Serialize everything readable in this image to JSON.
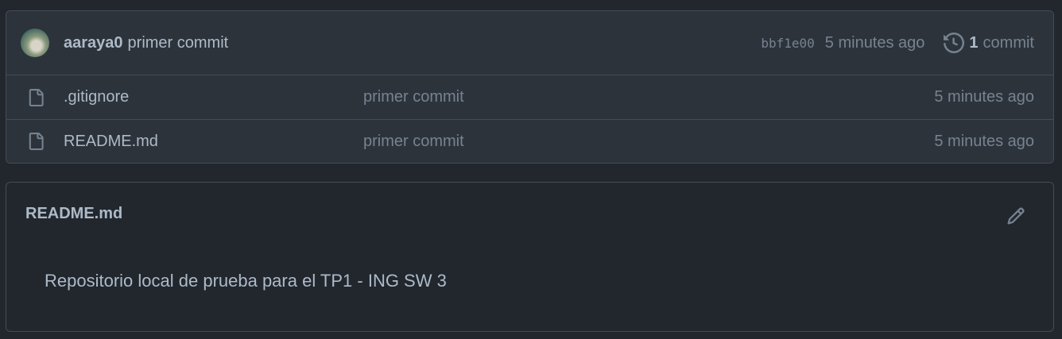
{
  "latest_commit": {
    "author": "aaraya0",
    "message": "primer commit",
    "sha": "bbf1e00",
    "time": "5 minutes ago",
    "history_count": "1",
    "history_label": "commit",
    "avatar_icon": "user-avatar"
  },
  "files": [
    {
      "name": ".gitignore",
      "commit": "primer commit",
      "time": "5 minutes ago",
      "icon": "file-icon"
    },
    {
      "name": "README.md",
      "commit": "primer commit",
      "time": "5 minutes ago",
      "icon": "file-icon"
    }
  ],
  "readme": {
    "title": "README.md",
    "content": "Repositorio local de prueba para el TP1 - ING SW 3",
    "edit_icon": "pencil-icon"
  },
  "colors": {
    "background": "#22272e",
    "box_background": "#2d333b",
    "border": "#444c56",
    "text": "#adbac7",
    "muted": "#768390"
  }
}
